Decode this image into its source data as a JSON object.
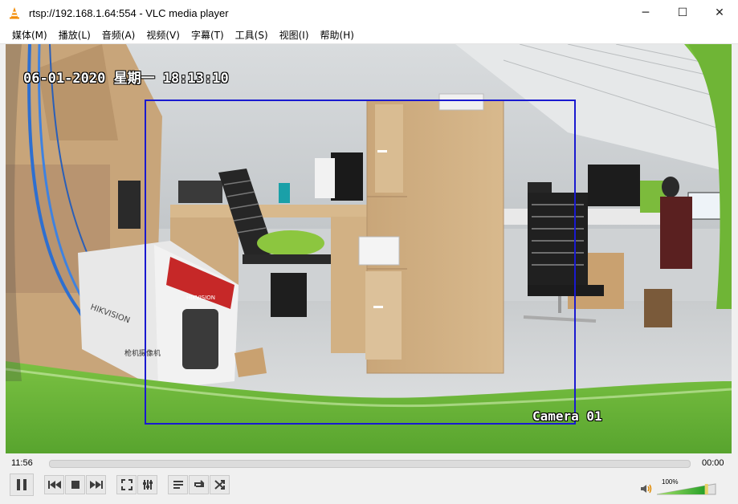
{
  "window": {
    "title": "rtsp://192.168.1.64:554 - VLC media player"
  },
  "window_controls": {
    "minimize": "─",
    "maximize": "☐",
    "close": "✕"
  },
  "menu": [
    {
      "label": "媒体(M)"
    },
    {
      "label": "播放(L)"
    },
    {
      "label": "音频(A)"
    },
    {
      "label": "视频(V)"
    },
    {
      "label": "字幕(T)"
    },
    {
      "label": "工具(S)"
    },
    {
      "label": "视图(I)"
    },
    {
      "label": "帮助(H)"
    }
  ],
  "video": {
    "osd_timestamp": "06-01-2020 星期一 18:13:10",
    "osd_camera": "Camera 01",
    "box_label": "HIKVISION",
    "box_label2": "HIKVISION",
    "box_text": "枪机摄像机",
    "highlight_color": "#1a1ad0"
  },
  "controls": {
    "elapsed": "11:56",
    "remaining": "00:00",
    "volume": "100%",
    "volume_level": 1.0,
    "seek_position": 0.0,
    "icons": {
      "pause": "pause-icon",
      "prev": "previous-icon",
      "stop": "stop-icon",
      "next": "next-icon",
      "fullscreen": "fullscreen-icon",
      "ext": "extended-settings-icon",
      "playlist": "playlist-icon",
      "loop": "loop-icon",
      "random": "random-icon",
      "speaker": "speaker-icon"
    }
  }
}
